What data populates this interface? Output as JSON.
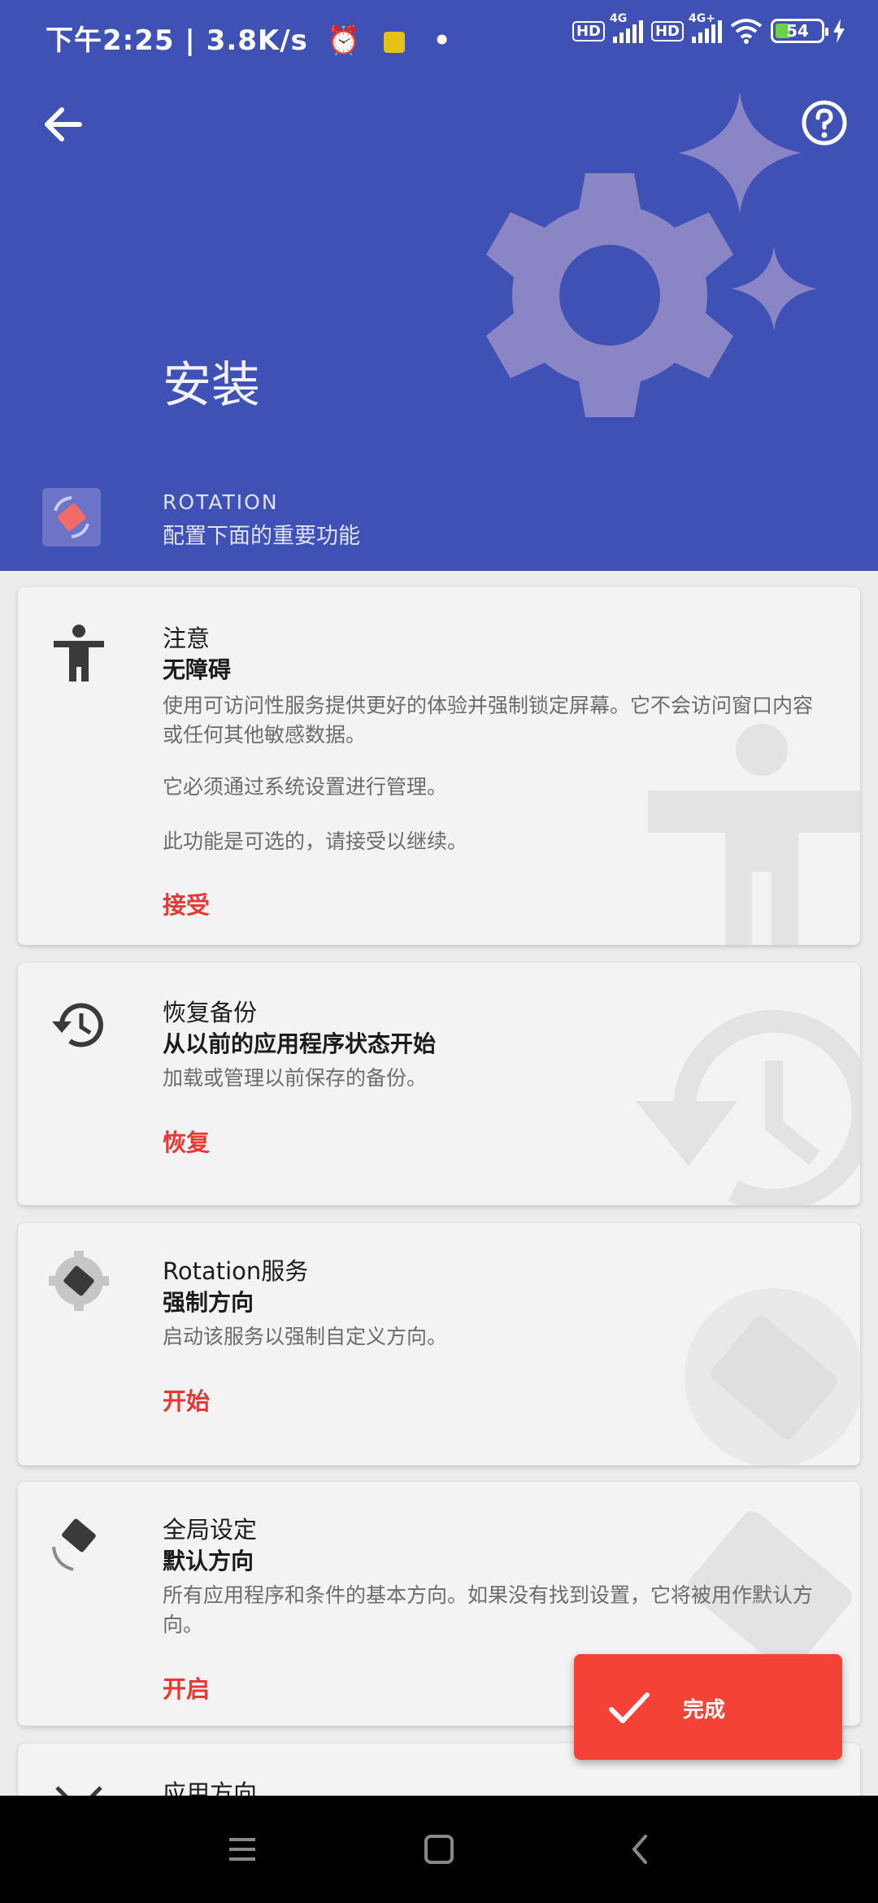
{
  "status_bar": {
    "time": "下午2:25",
    "separator": "|",
    "net_speed": "3.8K/s",
    "hd_1": "HD",
    "net_1": "4G",
    "hd_2": "HD",
    "net_2": "4G+",
    "battery": "54",
    "icons": [
      "alarm-icon",
      "app-notification-icon",
      "wifi-icon",
      "charging-icon"
    ]
  },
  "header": {
    "title": "安装",
    "app_name": "ROTATION",
    "app_subtitle": "配置下面的重要功能",
    "color": "#3f51b5"
  },
  "cards": [
    {
      "title": "注意",
      "subtitle": "无障碍",
      "body": [
        "使用可访问性服务提供更好的体验并强制锁定屏幕。它不会访问窗口内容或任何其他敏感数据。",
        "它必须通过系统设置进行管理。",
        "此功能是可选的，请接受以继续。"
      ],
      "action": "接受"
    },
    {
      "title": "恢复备份",
      "subtitle": "从以前的应用程序状态开始",
      "body": [
        "加载或管理以前保存的备份。"
      ],
      "action": "恢复"
    },
    {
      "title": "Rotation服务",
      "subtitle": "强制方向",
      "body": [
        "启动该服务以强制自定义方向。"
      ],
      "action": "开始"
    },
    {
      "title": "全局设定",
      "subtitle": "默认方向",
      "body": [
        "所有应用程序和条件的基本方向。如果没有找到设置，它将被用作默认方向。"
      ],
      "action": "开启"
    },
    {
      "title": "应用方向"
    }
  ],
  "fab": {
    "label": "完成",
    "color": "#f44336"
  },
  "accent": "#e53935"
}
